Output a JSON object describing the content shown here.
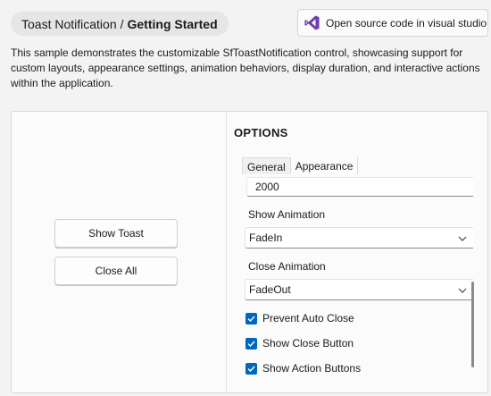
{
  "header": {
    "breadcrumb_parent": "Toast Notification",
    "breadcrumb_separator": "/",
    "breadcrumb_current": "Getting Started",
    "open_source_label": "Open source code in visual studio",
    "open_source_icon": "visual-studio-icon"
  },
  "description": "This sample demonstrates the customizable SfToastNotification control, showcasing support for custom layouts, appearance settings, animation behaviors, display duration, and interactive actions within the application.",
  "demo": {
    "show_toast_label": "Show Toast",
    "close_all_label": "Close All"
  },
  "options": {
    "title": "OPTIONS",
    "tabs": [
      {
        "label": "General",
        "active": true
      },
      {
        "label": "Appearance",
        "active": false
      }
    ],
    "duration_value": "2000",
    "show_animation_label": "Show Animation",
    "show_animation_value": "FadeIn",
    "close_animation_label": "Close Animation",
    "close_animation_value": "FadeOut",
    "checkboxes": [
      {
        "label": "Prevent Auto Close",
        "checked": true
      },
      {
        "label": "Show Close Button",
        "checked": true
      },
      {
        "label": "Show Action Buttons",
        "checked": true
      }
    ]
  },
  "colors": {
    "accent": "#0067c0",
    "vs_purple": "#6c3fae"
  }
}
